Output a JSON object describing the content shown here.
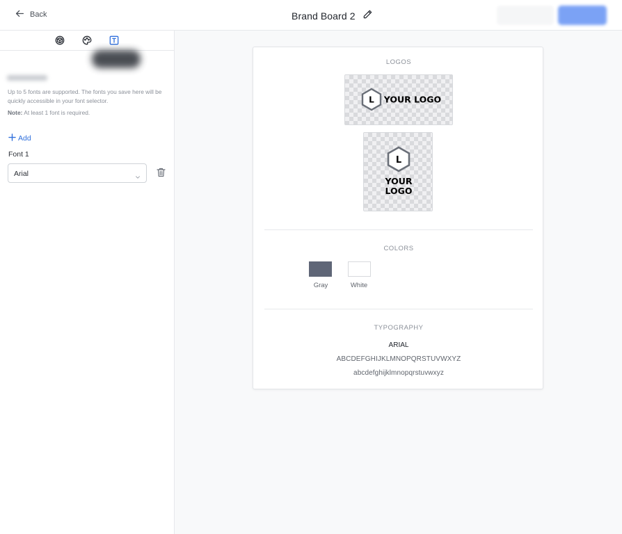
{
  "header": {
    "back_label": "Back",
    "title": "Brand Board 2"
  },
  "sidebar": {
    "tabs": [
      {
        "name": "brand-tab",
        "icon": "cube-icon"
      },
      {
        "name": "colors-tab",
        "icon": "palette-icon"
      },
      {
        "name": "fonts-tab",
        "icon": "text-icon",
        "active": true
      }
    ],
    "help_text": "Up to 5 fonts are supported. The fonts you save here will be quickly accessible in your font selector.",
    "note_label": "Note:",
    "note_text": " At least 1 font is required.",
    "add_label": "Add",
    "font_label": "Font 1",
    "font_value": "Arial"
  },
  "board": {
    "logos_title": "LOGOS",
    "logo_h_text": "YOUR LOGO",
    "logo_mark": "L",
    "logo_v_line1": "YOUR",
    "logo_v_line2": "LOGO",
    "colors_title": "COLORS",
    "colors": [
      {
        "name": "Gray",
        "hex": "#5f6677"
      },
      {
        "name": "White",
        "hex": "#ffffff"
      }
    ],
    "typography_title": "TYPOGRAPHY",
    "font_name": "ARIAL",
    "uppercase": "ABCDEFGHIJKLMNOPQRSTUVWXYZ",
    "lowercase": "abcdefghijklmnopqrstuvwxyz"
  },
  "theme": {
    "accent": "#2f6fdc",
    "primary_button": "#5b8cf3"
  }
}
